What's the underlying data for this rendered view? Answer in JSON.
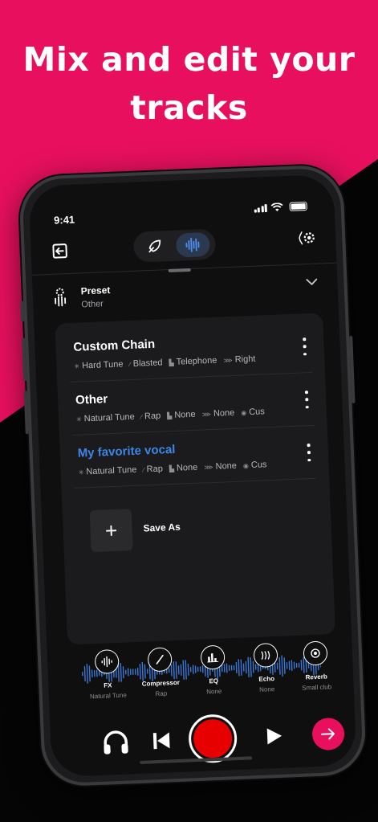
{
  "headline": "Mix and edit your\ntracks",
  "status": {
    "time": "9:41"
  },
  "preset": {
    "title": "Preset",
    "value": "Other"
  },
  "presets": [
    {
      "name": "Custom Chain",
      "favorite": false,
      "chips": [
        {
          "icon": "tune-icon",
          "label": "Hard Tune"
        },
        {
          "icon": "compressor-icon",
          "label": "Blasted"
        },
        {
          "icon": "eq-icon",
          "label": "Telephone"
        },
        {
          "icon": "echo-icon",
          "label": "Right"
        }
      ]
    },
    {
      "name": "Other",
      "favorite": false,
      "chips": [
        {
          "icon": "tune-icon",
          "label": "Natural Tune"
        },
        {
          "icon": "compressor-icon",
          "label": "Rap"
        },
        {
          "icon": "eq-icon",
          "label": "None"
        },
        {
          "icon": "echo-icon",
          "label": "None"
        },
        {
          "icon": "reverb-icon",
          "label": "Cus"
        }
      ]
    },
    {
      "name": "My favorite vocal",
      "favorite": true,
      "chips": [
        {
          "icon": "tune-icon",
          "label": "Natural Tune"
        },
        {
          "icon": "compressor-icon",
          "label": "Rap"
        },
        {
          "icon": "eq-icon",
          "label": "None"
        },
        {
          "icon": "echo-icon",
          "label": "None"
        },
        {
          "icon": "reverb-icon",
          "label": "Cus"
        }
      ]
    }
  ],
  "save_as": {
    "label": "Save As",
    "icon": "+"
  },
  "fx": [
    {
      "name": "FX",
      "value": "Natural Tune",
      "icon": "waveform-icon"
    },
    {
      "name": "Compressor",
      "value": "Rap",
      "icon": "compressor-icon"
    },
    {
      "name": "EQ",
      "value": "None",
      "icon": "eq-icon"
    },
    {
      "name": "Echo",
      "value": "None",
      "icon": "echo-icon"
    },
    {
      "name": "Reverb",
      "value": "Small club",
      "icon": "reverb-icon"
    }
  ],
  "colors": {
    "brand_pink": "#e8105e",
    "favorite_blue": "#3d86e6",
    "record_red": "#e60000",
    "wave_blue": "#3a78d6"
  }
}
